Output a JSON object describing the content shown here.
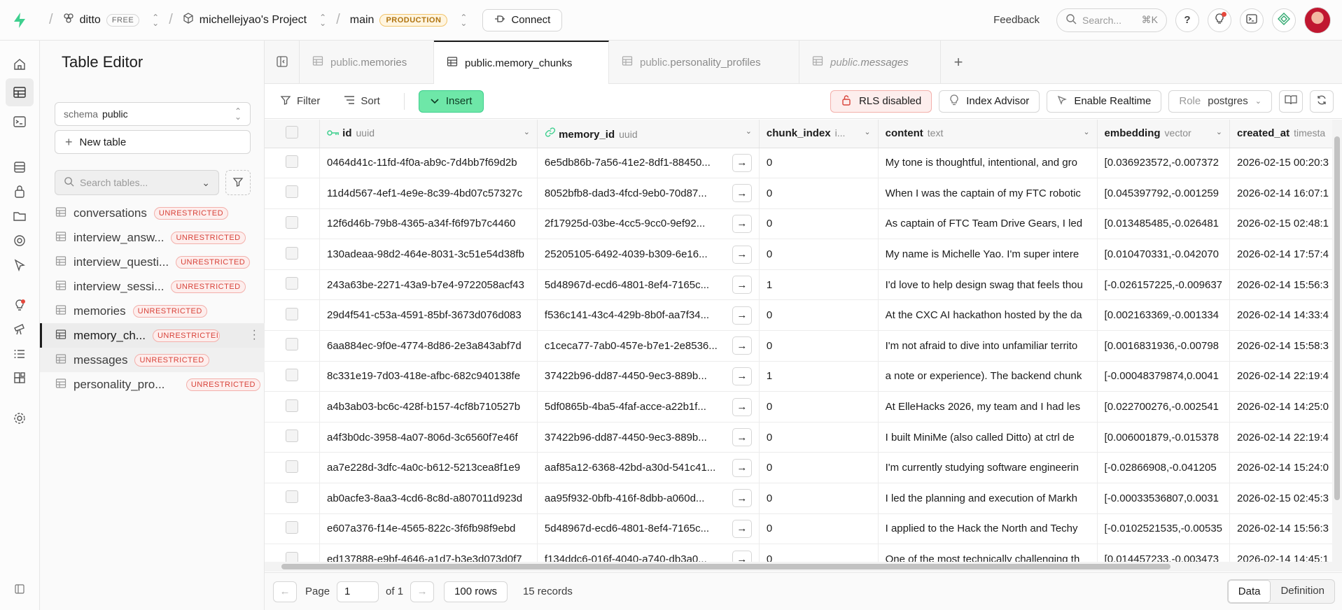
{
  "topbar": {
    "org": "ditto",
    "org_badge": "FREE",
    "project": "michellejyao's Project",
    "branch": "main",
    "branch_badge": "PRODUCTION",
    "connect_label": "Connect",
    "feedback_label": "Feedback",
    "search_placeholder": "Search...",
    "search_shortcut": "⌘K",
    "icons": [
      "help-icon",
      "lightbulb-icon",
      "terminal-icon",
      "assistant-icon",
      "avatar"
    ]
  },
  "rail": {
    "icons": [
      "home-icon",
      "table-editor-icon",
      "sql-editor-icon",
      "database-icon",
      "auth-icon",
      "storage-icon",
      "functions-icon",
      "realtime-icon",
      "advisors-icon",
      "reports-icon",
      "logs-icon",
      "integrations-icon",
      "settings-icon",
      "collapse-icon"
    ]
  },
  "sidebar": {
    "title": "Table Editor",
    "schema_label": "schema",
    "schema_value": "public",
    "new_table_label": "New table",
    "search_placeholder": "Search tables...",
    "tables": [
      {
        "name": "conversations",
        "badge": "UNRESTRICTED"
      },
      {
        "name": "interview_answ...",
        "badge": "UNRESTRICTED"
      },
      {
        "name": "interview_questi...",
        "badge": "UNRESTRICTED"
      },
      {
        "name": "interview_sessi...",
        "badge": "UNRESTRICTED"
      },
      {
        "name": "memories",
        "badge": "UNRESTRICTED"
      },
      {
        "name": "memory_ch...",
        "badge": "UNRESTRICTEI"
      },
      {
        "name": "messages",
        "badge": "UNRESTRICTED"
      },
      {
        "name": "personality_pro...",
        "badge": "UNRESTRICTED"
      }
    ]
  },
  "tabs": [
    {
      "schema": "public.",
      "name": "memories"
    },
    {
      "schema": "public.",
      "name": "memory_chunks"
    },
    {
      "schema": "public.",
      "name": "personality_profiles"
    },
    {
      "schema": "public.",
      "name": "messages"
    }
  ],
  "toolbar": {
    "filter_label": "Filter",
    "sort_label": "Sort",
    "insert_label": "Insert",
    "rls_label": "RLS disabled",
    "index_label": "Index Advisor",
    "realtime_label": "Enable Realtime",
    "role_label": "Role",
    "role_value": "postgres"
  },
  "grid": {
    "columns": [
      {
        "name": "id",
        "type": "uuid"
      },
      {
        "name": "memory_id",
        "type": "uuid"
      },
      {
        "name": "chunk_index",
        "type": "i..."
      },
      {
        "name": "content",
        "type": "text"
      },
      {
        "name": "embedding",
        "type": "vector"
      },
      {
        "name": "created_at",
        "type": "timesta"
      }
    ],
    "rows": [
      [
        "0464d41c-11fd-4f0a-ab9c-7d4bb7f69d2b",
        "6e5db86b-7a56-41e2-8df1-88450...",
        "0",
        "My tone is thoughtful, intentional, and gro",
        "[0.036923572,-0.007372",
        "2026-02-15 00:20:3"
      ],
      [
        "11d4d567-4ef1-4e9e-8c39-4bd07c57327c",
        "8052bfb8-dad3-4fcd-9eb0-70d87...",
        "0",
        "When I was the captain of my FTC robotic",
        "[0.045397792,-0.001259",
        "2026-02-14 16:07:1"
      ],
      [
        "12f6d46b-79b8-4365-a34f-f6f97b7c4460",
        "2f17925d-03be-4cc5-9cc0-9ef92...",
        "0",
        "As captain of FTC Team Drive Gears, I led",
        "[0.013485485,-0.026481",
        "2026-02-15 02:48:1"
      ],
      [
        "130adeaa-98d2-464e-8031-3c51e54d38fb",
        "25205105-6492-4039-b309-6e16...",
        "0",
        "My name is Michelle Yao. I'm super intere",
        "[0.010470331,-0.042070",
        "2026-02-14 17:57:4"
      ],
      [
        "243a63be-2271-43a9-b7e4-9722058acf43",
        "5d48967d-ecd6-4801-8ef4-7165c...",
        "1",
        "I'd love to help design swag that feels thou",
        "[-0.026157225,-0.009637",
        "2026-02-14 15:56:3"
      ],
      [
        "29d4f541-c53a-4591-85bf-3673d076d083",
        "f536c141-43c4-429b-8b0f-aa7f34...",
        "0",
        "At the CXC AI hackathon hosted by the da",
        "[0.002163369,-0.001334",
        "2026-02-14 14:33:4"
      ],
      [
        "6aa884ec-9f0e-4774-8d86-2e3a843abf7d",
        "c1ceca77-7ab0-457e-b7e1-2e8536...",
        "0",
        "I'm not afraid to dive into unfamiliar territo",
        "[0.0016831936,-0.00798",
        "2026-02-14 15:58:3"
      ],
      [
        "8c331e19-7d03-418e-afbc-682c940138fe",
        "37422b96-dd87-4450-9ec3-889b...",
        "1",
        "a note or experience). The backend chunk",
        "[-0.00048379874,0.0041",
        "2026-02-14 22:19:4"
      ],
      [
        "a4b3ab03-bc6c-428f-b157-4cf8b710527b",
        "5df0865b-4ba5-4faf-acce-a22b1f...",
        "0",
        "At ElleHacks 2026, my team and I had les",
        "[0.022700276,-0.002541",
        "2026-02-14 14:25:0"
      ],
      [
        "a4f3b0dc-3958-4a07-806d-3c6560f7e46f",
        "37422b96-dd87-4450-9ec3-889b...",
        "0",
        "I built MiniMe (also called Ditto) at ctrl de",
        "[0.006001879,-0.015378",
        "2026-02-14 22:19:4"
      ],
      [
        "aa7e228d-3dfc-4a0c-b612-5213cea8f1e9",
        "aaf85a12-6368-42bd-a30d-541c41...",
        "0",
        "I'm currently studying software engineerin",
        "[-0.02866908,-0.041205",
        "2026-02-14 15:24:0"
      ],
      [
        "ab0acfe3-8aa3-4cd6-8c8d-a807011d923d",
        "aa95f932-0bfb-416f-8dbb-a060d...",
        "0",
        "I led the planning and execution of Markh",
        "[-0.00033536807,0.0031",
        "2026-02-15 02:45:3"
      ],
      [
        "e607a376-f14e-4565-822c-3f6fb98f9ebd",
        "5d48967d-ecd6-4801-8ef4-7165c...",
        "0",
        "I applied to the Hack the North and Techy",
        "[-0.0102521535,-0.00535",
        "2026-02-14 15:56:3"
      ],
      [
        "ed137888-e9bf-4646-a1d7-b3e3d073d0f7",
        "f134ddc6-016f-4040-a740-db3a0...",
        "0",
        "One of the most technically challenging th",
        "[0.014457233,-0.003473",
        "2026-02-14 14:45:1"
      ]
    ]
  },
  "footer": {
    "page_label": "Page",
    "page_value": "1",
    "of_label": "of 1",
    "rows_label": "100 rows",
    "records_label": "15 records",
    "data_label": "Data",
    "definition_label": "Definition"
  }
}
